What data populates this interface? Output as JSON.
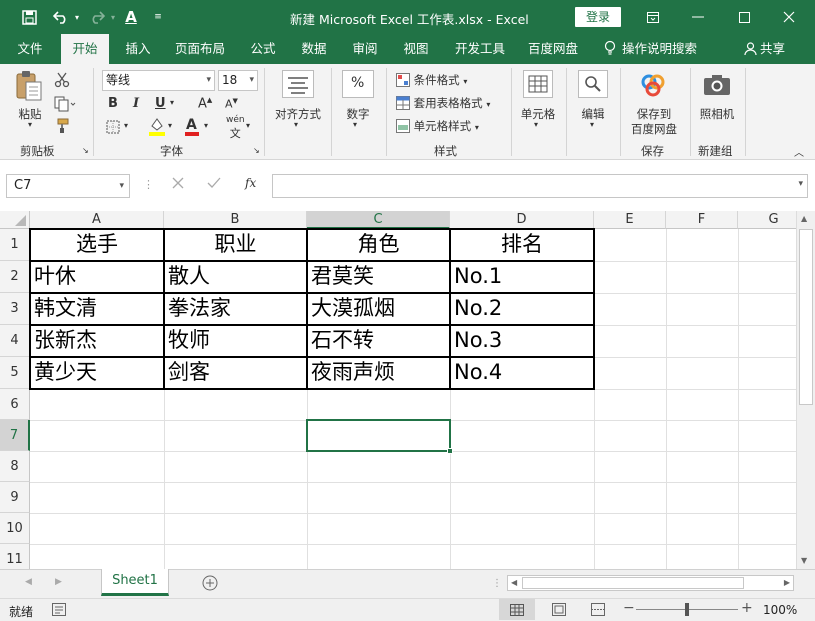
{
  "titlebar": {
    "title": "新建 Microsoft Excel 工作表.xlsx  -  Excel",
    "login": "登录",
    "font_color_letter": "A"
  },
  "menu": {
    "tabs": [
      "文件",
      "开始",
      "插入",
      "页面布局",
      "公式",
      "数据",
      "审阅",
      "视图",
      "开发工具",
      "百度网盘"
    ],
    "help": "操作说明搜索",
    "share": "共享",
    "active_index": 1
  },
  "ribbon": {
    "clipboard": {
      "paste": "粘贴",
      "label": "剪贴板"
    },
    "font": {
      "name": "等线",
      "size": "18",
      "bold": "B",
      "italic": "I",
      "underline": "U",
      "grow": "A",
      "shrink": "A",
      "label": "字体",
      "wen": "wén"
    },
    "align": {
      "label": "对齐方式"
    },
    "number": {
      "label": "数字",
      "symbol": "%"
    },
    "styles": {
      "conditional": "条件格式",
      "table": "套用表格格式",
      "cell": "单元格样式",
      "label": "样式"
    },
    "cells": {
      "label": "单元格"
    },
    "edit": {
      "label": "编辑"
    },
    "save": {
      "line1": "保存到",
      "line2": "百度网盘",
      "label": "保存"
    },
    "camera": {
      "label": "照相机",
      "group": "新建组"
    }
  },
  "formula_bar": {
    "name_box": "C7",
    "fx": "fx",
    "formula": ""
  },
  "columns": [
    "A",
    "B",
    "C",
    "D",
    "E",
    "F",
    "G"
  ],
  "rows": [
    "1",
    "2",
    "3",
    "4",
    "5",
    "6",
    "7",
    "8",
    "9",
    "10",
    "11"
  ],
  "selected_cell": "C7",
  "table": {
    "headers": [
      "选手",
      "职业",
      "角色",
      "排名"
    ],
    "rows": [
      [
        "叶休",
        "散人",
        "君莫笑",
        "No.1"
      ],
      [
        "韩文清",
        "拳法家",
        "大漠孤烟",
        "No.2"
      ],
      [
        "张新杰",
        "牧师",
        "石不转",
        "No.3"
      ],
      [
        "黄少天",
        "剑客",
        "夜雨声烦",
        "No.4"
      ]
    ]
  },
  "sheet_tabs": [
    "Sheet1"
  ],
  "status": {
    "mode": "就绪",
    "zoom": "100%",
    "zoom_level": 1.0
  },
  "colors": {
    "excel_green": "#217346",
    "ribbon_bg": "#f3f3f3",
    "header_bg": "#f3f3f3"
  }
}
